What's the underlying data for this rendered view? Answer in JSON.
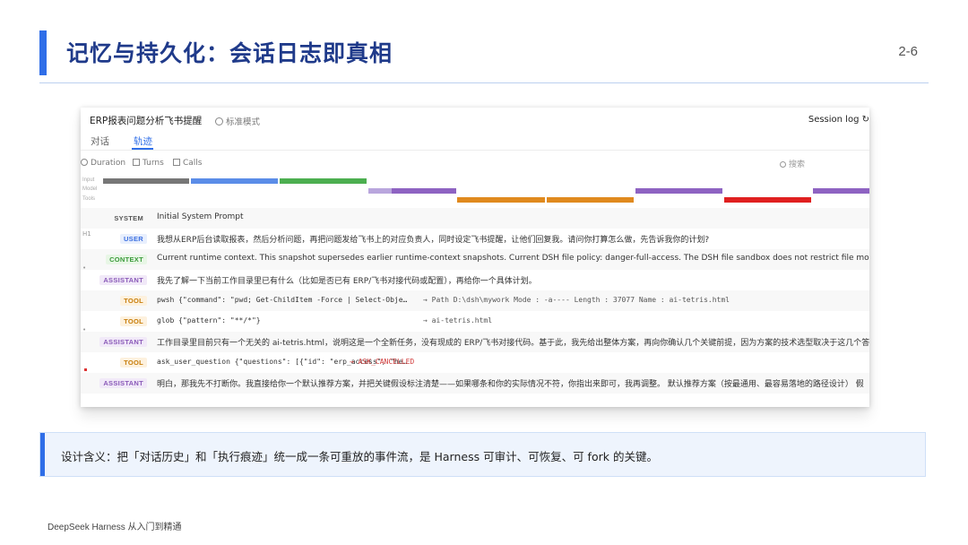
{
  "slide": {
    "title": "记忆与持久化：会话日志即真相",
    "page": "2-6",
    "note": "设计含义：把「对话历史」和「执行痕迹」统一成一条可重放的事件流，是 Harness 可审计、可恢复、可 fork 的关键。",
    "footer": "DeepSeek Harness 从入门到精通",
    "accent_color": "#2f6ee8"
  },
  "app": {
    "title": "ERP报表问题分析飞书提醒",
    "mode": "标准模式",
    "session_log": "Session log",
    "tabs": [
      "对话",
      "轨迹"
    ],
    "active_tab": "轨迹",
    "filters": {
      "duration": "Duration",
      "turns": "Turns",
      "calls": "Calls"
    },
    "search_placeholder": "搜索",
    "timeline": {
      "lanes": [
        "Input",
        "Model",
        "Tools"
      ],
      "colors": {
        "input": "#777777",
        "user": "#5b8de8",
        "context": "#4caf50",
        "assistant": "#8e63c2",
        "tool": "#e08a1e",
        "error": "#e02020"
      }
    },
    "rows": [
      {
        "role": "SYSTEM",
        "text": "Initial System Prompt"
      },
      {
        "role": "USER",
        "text": "我想从ERP后台读取报表，然后分析问题，再把问题发给飞书上的对应负责人，同时设定飞书提醒，让他们回复我。请问你打算怎么做，先告诉我你的计划?"
      },
      {
        "role": "CONTEXT",
        "text": "Current runtime context. This snapshot supersedes earlier runtime-context snapshots. Current DSH file policy: danger-full-access. The DSH file sandbox does not restrict file modifications by available"
      },
      {
        "role": "ASSISTANT",
        "text": "我先了解一下当前工作目录里已有什么（比如是否已有 ERP/飞书对接代码或配置），再给你一个具体计划。"
      },
      {
        "role": "TOOL",
        "text": "pwsh {\"command\": \"pwd; Get-ChildItem -Force | Select-Obje…",
        "result": "→ Path D:\\dsh\\mywork Mode : -a---- Length : 37077 Name : ai-tetris.html"
      },
      {
        "role": "TOOL",
        "text": "glob {\"pattern\": \"**/*\"}",
        "result": "→ ai-tetris.html"
      },
      {
        "role": "ASSISTANT",
        "text": "工作目录里目前只有一个无关的 ai-tetris.html，说明这是一个全新任务，没有现成的 ERP/飞书对接代码。基于此，我先给出整体方案，再向你确认几个关键前提，因为方案的技术选型取决于这几个答案"
      },
      {
        "role": "TOOL",
        "text": "ask_user_question {\"questions\": [{\"id\": \"erp_access\", \"he…",
        "result": "→ ASK_CANCELLED"
      },
      {
        "role": "ASSISTANT",
        "text": "明白，那我先不打断你。我直接给你一个默认推荐方案，并把关键假设标注清楚——如果哪条和你的实际情况不符，你指出来即可，我再调整。 默认推荐方案（按最通用、最容易落地的路径设计） 假"
      }
    ]
  }
}
